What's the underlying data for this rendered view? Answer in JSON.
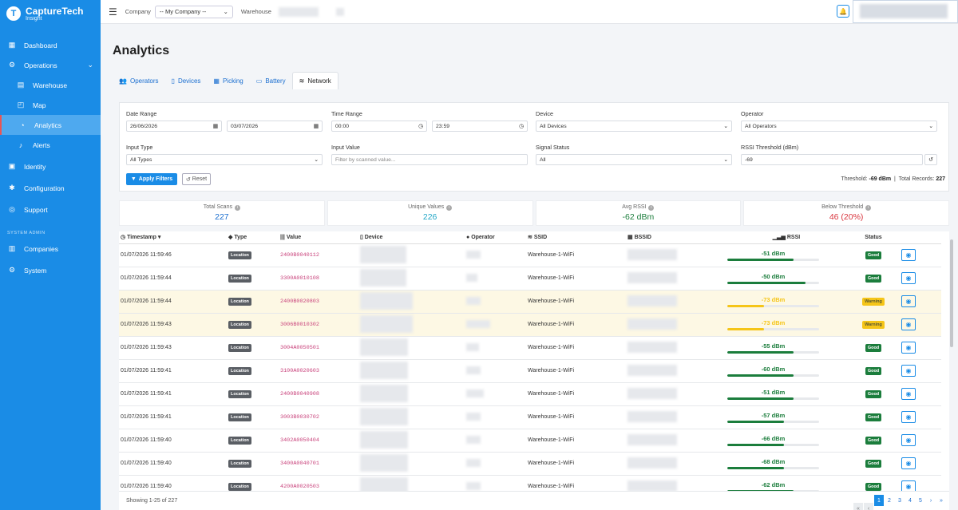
{
  "brand": {
    "name": "CaptureTech",
    "sub": "Insight",
    "logo": "T"
  },
  "sidebar": {
    "items": [
      {
        "label": "Dashboard",
        "icon": "dashboard-icon",
        "glyph": "▦"
      },
      {
        "label": "Operations",
        "icon": "operations-icon",
        "glyph": "⚙"
      },
      {
        "label": "Warehouse",
        "icon": "warehouse-icon",
        "glyph": "▤"
      },
      {
        "label": "Map",
        "icon": "map-icon",
        "glyph": "◰"
      },
      {
        "label": "Analytics",
        "icon": "analytics-icon",
        "glyph": "◔"
      },
      {
        "label": "Alerts",
        "icon": "bell-icon",
        "glyph": "♪"
      },
      {
        "label": "Identity",
        "icon": "identity-icon",
        "glyph": "▣"
      },
      {
        "label": "Configuration",
        "icon": "configuration-icon",
        "glyph": "✱"
      },
      {
        "label": "Support",
        "icon": "support-icon",
        "glyph": "◎"
      },
      {
        "label": "Companies",
        "icon": "companies-icon",
        "glyph": "▥"
      },
      {
        "label": "System",
        "icon": "system-icon",
        "glyph": "⚙"
      }
    ],
    "section": "SYSTEM ADMIN"
  },
  "topbar": {
    "company_label": "Company",
    "company_value": "-- My Company --",
    "warehouse_label": "Warehouse"
  },
  "page": {
    "title": "Analytics"
  },
  "tabs": [
    {
      "label": "Operators",
      "icon": "users-icon",
      "glyph": "👥"
    },
    {
      "label": "Devices",
      "icon": "mobile-icon",
      "glyph": "▯"
    },
    {
      "label": "Picking",
      "icon": "boxes-icon",
      "glyph": "▦"
    },
    {
      "label": "Battery",
      "icon": "battery-icon",
      "glyph": "▭"
    },
    {
      "label": "Network",
      "icon": "wifi-icon",
      "glyph": "≋"
    }
  ],
  "filters": {
    "date_range_label": "Date Range",
    "date_from": "26/06/2026",
    "date_to": "03/07/2026",
    "time_range_label": "Time Range",
    "time_from": "00:00",
    "time_to": "23:59",
    "device_label": "Device",
    "device_value": "All Devices",
    "operator_label": "Operator",
    "operator_value": "All Operators",
    "input_type_label": "Input Type",
    "input_type_value": "All Types",
    "input_value_label": "Input Value",
    "input_value_placeholder": "Filter by scanned value...",
    "signal_label": "Signal Status",
    "signal_value": "All",
    "rssi_label": "RSSI Threshold (dBm)",
    "rssi_value": "-69",
    "apply": "Apply Filters",
    "reset": "Reset",
    "threshold_text": "Threshold:",
    "threshold_value": "-69 dBm",
    "total_text": "Total Records:",
    "total_value": "227"
  },
  "stats": [
    {
      "label": "Total Scans",
      "value": "227",
      "color": "#1a6ed0"
    },
    {
      "label": "Unique Values",
      "value": "226",
      "color": "#22a7c7"
    },
    {
      "label": "Avg RSSI",
      "value": "-62 dBm",
      "color": "#1b7d3c"
    },
    {
      "label": "Below Threshold",
      "value": "46 (20%)",
      "color": "#d9363e"
    }
  ],
  "table": {
    "headers": {
      "timestamp": "Timestamp",
      "type": "Type",
      "value": "Value",
      "device": "Device",
      "operator": "Operator",
      "ssid": "SSID",
      "bssid": "BSSID",
      "rssi": "RSSI",
      "status": "Status"
    },
    "rows": [
      {
        "ts": "01/07/2026 11:59:46",
        "type": "Location",
        "value": "2400B0040112",
        "ssid": "Warehouse-1-WiFi",
        "rssi": "-51 dBm",
        "level": 0.72,
        "status": "Good"
      },
      {
        "ts": "01/07/2026 11:59:44",
        "type": "Location",
        "value": "3300A0010108",
        "ssid": "Warehouse-1-WiFi",
        "rssi": "-50 dBm",
        "level": 0.85,
        "status": "Good"
      },
      {
        "ts": "01/07/2026 11:59:44",
        "type": "Location",
        "value": "2400B0020803",
        "ssid": "Warehouse-1-WiFi",
        "rssi": "-73 dBm",
        "level": 0.4,
        "status": "Warning"
      },
      {
        "ts": "01/07/2026 11:59:43",
        "type": "Location",
        "value": "3006B0010302",
        "ssid": "Warehouse-1-WiFi",
        "rssi": "-73 dBm",
        "level": 0.4,
        "status": "Warning"
      },
      {
        "ts": "01/07/2026 11:59:43",
        "type": "Location",
        "value": "3004A0050501",
        "ssid": "Warehouse-1-WiFi",
        "rssi": "-55 dBm",
        "level": 0.72,
        "status": "Good"
      },
      {
        "ts": "01/07/2026 11:59:41",
        "type": "Location",
        "value": "3100A0020603",
        "ssid": "Warehouse-1-WiFi",
        "rssi": "-60 dBm",
        "level": 0.72,
        "status": "Good"
      },
      {
        "ts": "01/07/2026 11:59:41",
        "type": "Location",
        "value": "2400B0040908",
        "ssid": "Warehouse-1-WiFi",
        "rssi": "-51 dBm",
        "level": 0.72,
        "status": "Good"
      },
      {
        "ts": "01/07/2026 11:59:41",
        "type": "Location",
        "value": "3003B0030702",
        "ssid": "Warehouse-1-WiFi",
        "rssi": "-57 dBm",
        "level": 0.62,
        "status": "Good"
      },
      {
        "ts": "01/07/2026 11:59:40",
        "type": "Location",
        "value": "3402A0050404",
        "ssid": "Warehouse-1-WiFi",
        "rssi": "-66 dBm",
        "level": 0.62,
        "status": "Good"
      },
      {
        "ts": "01/07/2026 11:59:40",
        "type": "Location",
        "value": "3400A0040701",
        "ssid": "Warehouse-1-WiFi",
        "rssi": "-68 dBm",
        "level": 0.62,
        "status": "Good"
      },
      {
        "ts": "01/07/2026 11:59:40",
        "type": "Location",
        "value": "4200A0020503",
        "ssid": "Warehouse-1-WiFi",
        "rssi": "-62 dBm",
        "level": 0.72,
        "status": "Good"
      }
    ]
  },
  "footer": {
    "showing": "Showing 1-25 of 227",
    "pages": [
      "1",
      "2",
      "3",
      "4",
      "5"
    ]
  },
  "colors": {
    "accent": "#1a8ce6",
    "good": "#1b7d3c",
    "warning": "#f5c518"
  }
}
